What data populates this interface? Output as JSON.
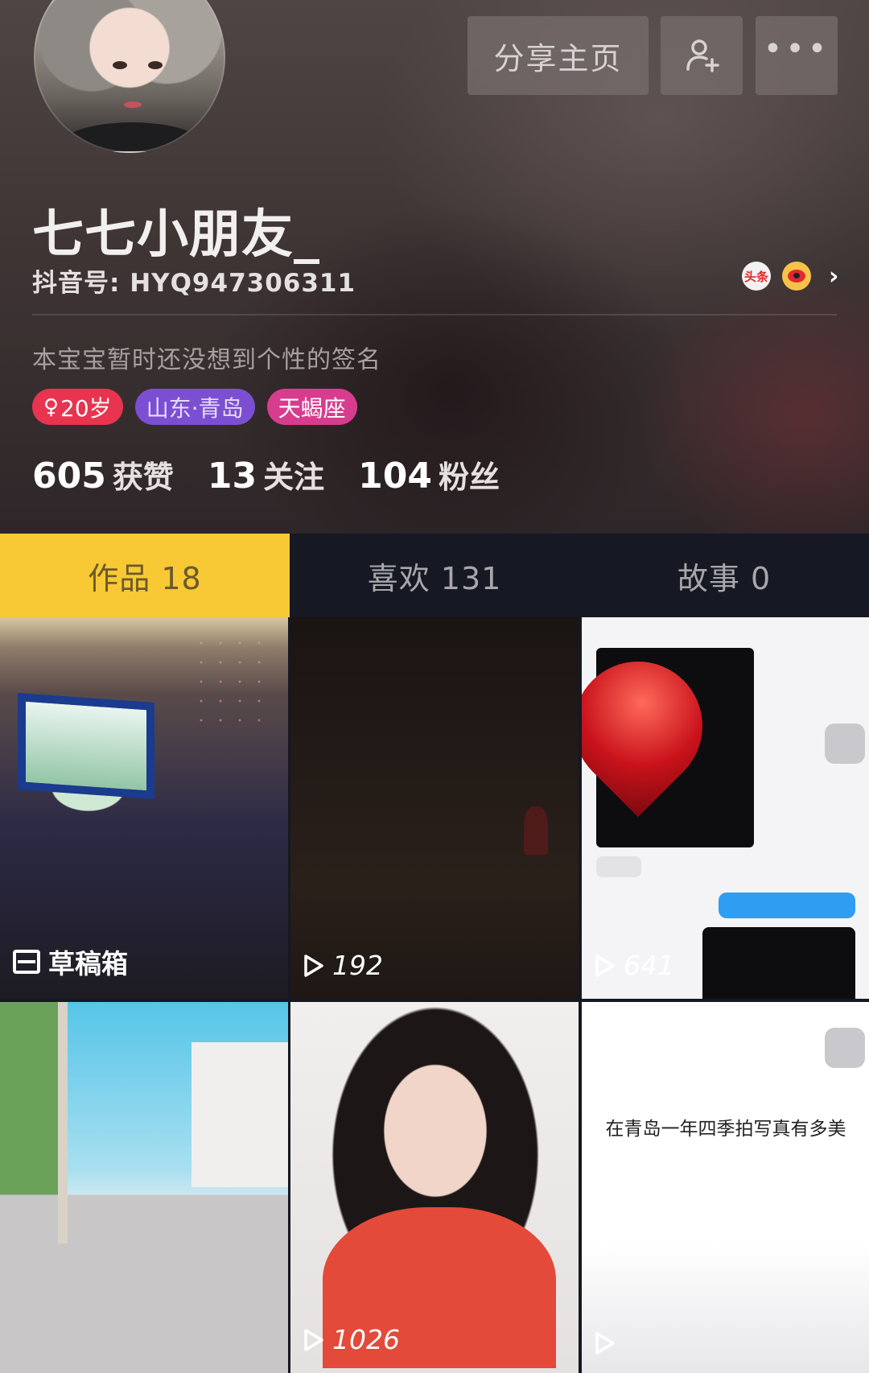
{
  "header": {
    "share_label": "分享主页",
    "nickname": "七七小朋友_",
    "douyin_id": "抖音号: HYQ947306311",
    "toutiao_icon_text": "头条",
    "signature": "本宝宝暂时还没想到个性的签名",
    "tags": {
      "age": "20岁",
      "location": "山东·青岛",
      "zodiac": "天蝎座"
    },
    "stats": {
      "likes_num": "605",
      "likes_label": "获赞",
      "following_num": "13",
      "following_label": "关注",
      "followers_num": "104",
      "followers_label": "粉丝"
    }
  },
  "tabs": [
    {
      "label": "作品 18",
      "active": true
    },
    {
      "label": "喜欢 131",
      "active": false
    },
    {
      "label": "故事 0",
      "active": false
    }
  ],
  "grid": [
    {
      "overlay": "草稿箱",
      "kind": "draft"
    },
    {
      "overlay": "192",
      "kind": "play"
    },
    {
      "overlay": "641",
      "kind": "play"
    },
    {
      "overlay": "",
      "kind": "image"
    },
    {
      "overlay": "1026",
      "kind": "play"
    },
    {
      "overlay": "",
      "kind": "play",
      "caption": "在青岛一年四季拍写真有多美"
    }
  ],
  "colors": {
    "active_tab": "#f8c934",
    "tag_age": "#e8344f",
    "tag_location": "#7c4fd2",
    "tag_zodiac": "#d83c8e",
    "background": "#161823"
  },
  "icons": [
    "user-add-icon",
    "more-icon",
    "toutiao-icon",
    "weibo-icon",
    "chevron-right-icon",
    "female-icon",
    "play-icon",
    "draft-icon"
  ]
}
